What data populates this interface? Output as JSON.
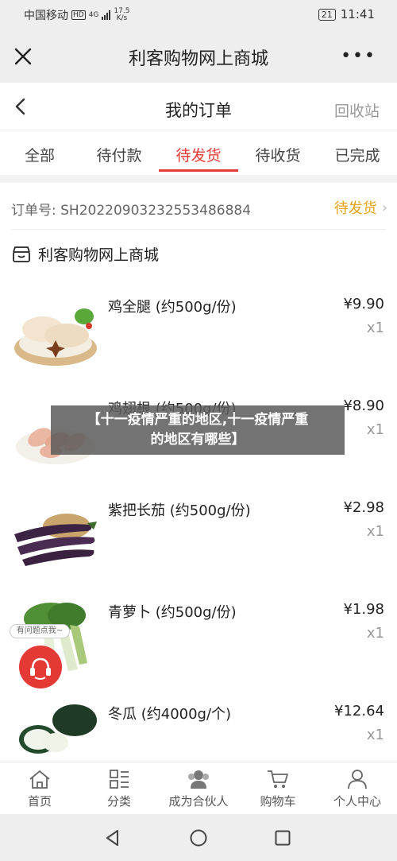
{
  "status_bar": {
    "carrier": "中国移动",
    "hd_badge": "HD",
    "network": "4G",
    "speed_value": "17.5",
    "speed_unit": "K/s",
    "battery": "21",
    "time": "11:41"
  },
  "app_bar": {
    "title": "利客购物网上商城",
    "close_icon": "close-icon",
    "more_label": "•••"
  },
  "page_header": {
    "title": "我的订单",
    "recycle_label": "回收站"
  },
  "tabs": [
    {
      "label": "全部",
      "active": false
    },
    {
      "label": "待付款",
      "active": false
    },
    {
      "label": "待发货",
      "active": true
    },
    {
      "label": "待收货",
      "active": false
    },
    {
      "label": "已完成",
      "active": false
    }
  ],
  "order": {
    "number_label": "订单号: SH20220903232553486884",
    "status": "待发货",
    "shop_name": "利客购物网上商城",
    "items": [
      {
        "name": "鸡全腿 (约500g/份)",
        "price": "¥9.90",
        "qty": "x1"
      },
      {
        "name": "鸡翅根 (约500g/份)",
        "price": "¥8.90",
        "qty": "x1"
      },
      {
        "name": "紫把长茄 (约500g/份)",
        "price": "¥2.98",
        "qty": "x1"
      },
      {
        "name": "青萝卜 (约500g/份)",
        "price": "¥1.98",
        "qty": "x1"
      },
      {
        "name": "冬瓜 (约4000g/个)",
        "price": "¥12.64",
        "qty": "x1"
      }
    ]
  },
  "overlay": {
    "line1": "【十一疫情严重的地区,十一疫情严重",
    "line2": "的地区有哪些】"
  },
  "help_tag": "有问题点我~",
  "bottom_tabs": [
    {
      "label": "首页",
      "icon": "home-icon"
    },
    {
      "label": "分类",
      "icon": "category-icon"
    },
    {
      "label": "成为合伙人",
      "icon": "partner-icon"
    },
    {
      "label": "购物车",
      "icon": "cart-icon"
    },
    {
      "label": "个人中心",
      "icon": "user-icon"
    }
  ],
  "colors": {
    "accent": "#e53935",
    "status_orange": "#e8a317"
  }
}
